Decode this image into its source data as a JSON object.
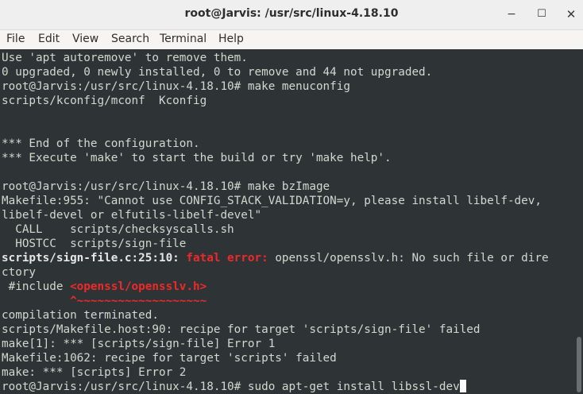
{
  "window": {
    "title": "root@Jarvis: /usr/src/linux-4.18.10",
    "controls": {
      "minimize": "−",
      "maximize": "☐",
      "close": "✕"
    }
  },
  "menu": [
    "File",
    "Edit",
    "View",
    "Search",
    "Terminal",
    "Help"
  ],
  "terminal": {
    "l1": "Use 'apt autoremove' to remove them.",
    "l2": "0 upgraded, 0 newly installed, 0 to remove and 44 not upgraded.",
    "l3": "root@Jarvis:/usr/src/linux-4.18.10# make menuconfig",
    "l4": "scripts/kconfig/mconf  Kconfig",
    "l7": "*** End of the configuration.",
    "l8": "*** Execute 'make' to start the build or try 'make help'.",
    "l10": "root@Jarvis:/usr/src/linux-4.18.10# make bzImage",
    "l11": "Makefile:955: \"Cannot use CONFIG_STACK_VALIDATION=y, please install libelf-dev,",
    "l12": "libelf-devel or elfutils-libelf-devel\"",
    "l13": "  CALL    scripts/checksyscalls.sh",
    "l14": "  HOSTCC  scripts/sign-file",
    "l15_loc": "scripts/sign-file.c:25:10: ",
    "l15_err": "fatal error: ",
    "l15_msg": "openssl/opensslv.h: No such file or dire",
    "l16": "ctory",
    "l17_pre": " #include ",
    "l17_hdr": "<openssl/opensslv.h>",
    "l18_caret": "          ^~~~~~~~~~~~~~~~~~~~",
    "l19": "compilation terminated.",
    "l20": "scripts/Makefile.host:90: recipe for target 'scripts/sign-file' failed",
    "l21": "make[1]: *** [scripts/sign-file] Error 1",
    "l22": "Makefile:1062: recipe for target 'scripts' failed",
    "l23": "make: *** [scripts] Error 2",
    "l24": "root@Jarvis:/usr/src/linux-4.18.10# sudo apt-get install libssl-dev"
  }
}
